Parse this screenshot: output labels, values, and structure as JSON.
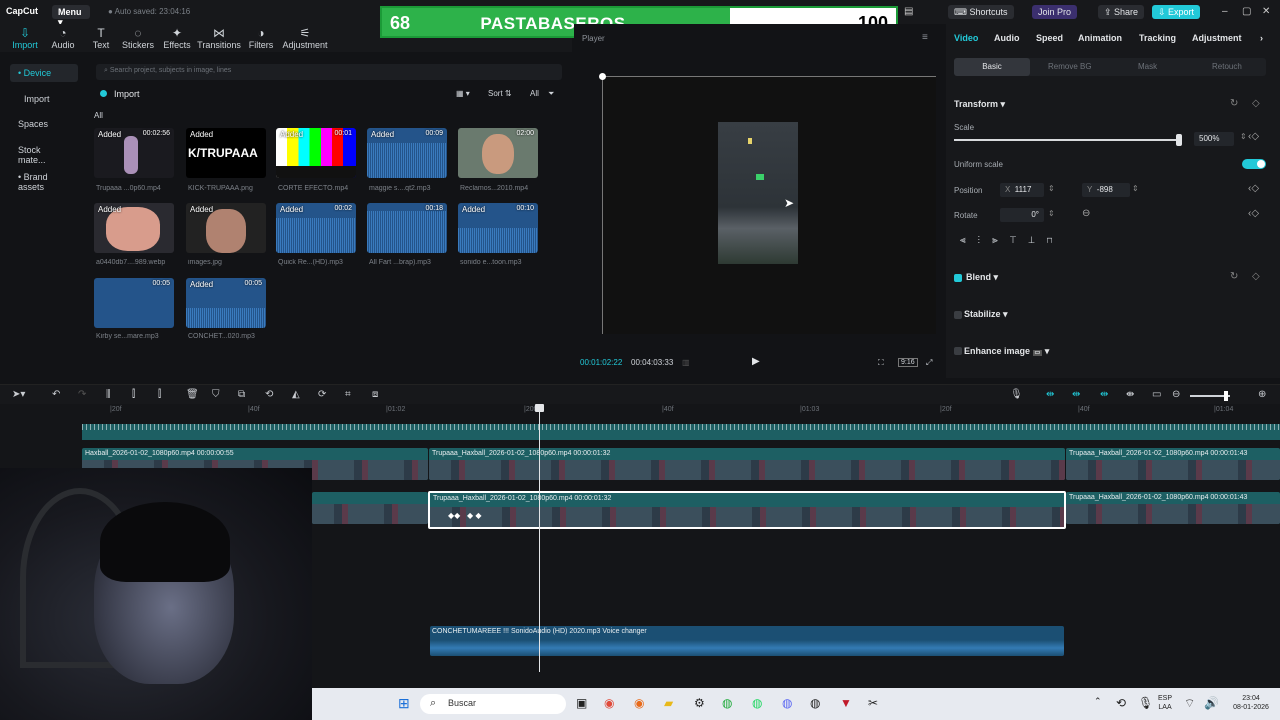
{
  "app": {
    "logo": "CapCut",
    "menu_label": "Menu",
    "autosave": "Auto saved: 23:04:16",
    "shortcuts": "Shortcuts",
    "join_pro": "Join Pro",
    "share": "Share",
    "export": "Export"
  },
  "score_overlay": {
    "left_score": "68",
    "title": "PASTABASEROS",
    "right_score": "100"
  },
  "media_tabs": [
    {
      "label": "Import",
      "icon": "import-icon"
    },
    {
      "label": "Audio",
      "icon": "audio-icon"
    },
    {
      "label": "Text",
      "icon": "text-icon"
    },
    {
      "label": "Stickers",
      "icon": "stickers-icon"
    },
    {
      "label": "Effects",
      "icon": "effects-icon"
    },
    {
      "label": "Transitions",
      "icon": "transitions-icon"
    },
    {
      "label": "Filters",
      "icon": "filters-icon"
    },
    {
      "label": "Adjustment",
      "icon": "adjustment-icon"
    }
  ],
  "left_nav": [
    "• Device",
    "Import",
    "Spaces",
    "Stock mate...",
    "• Brand assets"
  ],
  "media_panel": {
    "search_placeholder": "Search project, subjects in image, lines",
    "import_label": "Import",
    "sort": "Sort",
    "all_filter": "All",
    "all_label": "All",
    "items": [
      {
        "name": "Trupaaa ...0p60.mp4",
        "added": "Added",
        "duration": "00:02:56"
      },
      {
        "name": "KICK-TRUPAAA.png",
        "added": "Added",
        "duration": "",
        "logo_text": "K/TRUPAAA"
      },
      {
        "name": "CORTE EFECTO.mp4",
        "added": "Added",
        "duration": "00:01"
      },
      {
        "name": "maggie s....qt2.mp3",
        "added": "Added",
        "duration": "00:09"
      },
      {
        "name": "Reclamos...2010.mp4",
        "added": "",
        "duration": "02:00"
      },
      {
        "name": "a0440db7....989.webp",
        "added": "Added",
        "duration": ""
      },
      {
        "name": "images.jpg",
        "added": "Added",
        "duration": ""
      },
      {
        "name": "Quick Re...(HD).mp3",
        "added": "Added",
        "duration": "00:02"
      },
      {
        "name": "All Fart ...brap).mp3",
        "added": "",
        "duration": "00:18"
      },
      {
        "name": "sonido e...toon.mp3",
        "added": "Added",
        "duration": "00:10"
      },
      {
        "name": "Kirby se...mare.mp3",
        "added": "",
        "duration": "00:05"
      },
      {
        "name": "CONCHET...020.mp3",
        "added": "Added",
        "duration": "00:05"
      }
    ]
  },
  "player": {
    "title": "Player",
    "current_time": "00:01:02:22",
    "total_time": "00:04:03:33",
    "ratio": "9:16"
  },
  "inspector": {
    "tabs": [
      "Video",
      "Audio",
      "Speed",
      "Animation",
      "Tracking",
      "Adjustment"
    ],
    "subtabs": [
      "Basic",
      "Remove BG",
      "Mask",
      "Retouch"
    ],
    "transform": "Transform",
    "scale_label": "Scale",
    "scale_value": "500%",
    "scale_level_percent": 100,
    "uniform_scale": "Uniform scale",
    "position_label": "Position",
    "pos_x_label": "X",
    "pos_x": "1117",
    "pos_y_label": "Y",
    "pos_y": "-898",
    "rotate_label": "Rotate",
    "rotate_value": "0°",
    "blend": "Blend",
    "stabilize": "Stabilize",
    "enhance_image": "Enhance image",
    "accent_color": "#22c9d8"
  },
  "timeline": {
    "ruler": [
      "|20f",
      "|40f",
      "|01:02",
      "|20f",
      "|40f",
      "|01:03",
      "|20f",
      "|40f",
      "|01:04"
    ],
    "clips_top": [
      {
        "label": "Haxball_2026-01-02_1080p60.mp4   00:00:00:55"
      },
      {
        "label": "Trupaaa_Haxball_2026-01-02_1080p60.mp4   00:00:01:32"
      },
      {
        "label": "Trupaaa_Haxball_2026-01-02_1080p60.mp4   00:00:01:43"
      }
    ],
    "clips_mid": [
      {
        "label": "Trupaaa_Haxball_2026-01-02_1080p60.mp4   00:00:01:32"
      },
      {
        "label": "Trupaaa_Haxball_2026-01-02_1080p60.mp4   00:00:01:43"
      }
    ],
    "audio_clip": "CONCHETUMAREEE !!! SonidoAudio (HD) 2020.mp3   Voice changer"
  },
  "taskbar": {
    "search": "Buscar",
    "lang": "ESP",
    "lang2": "LAA",
    "time": "23:04",
    "date": "08-01-2026"
  }
}
